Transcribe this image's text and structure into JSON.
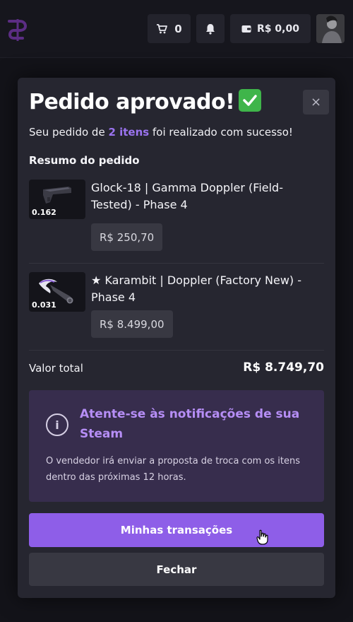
{
  "header": {
    "cart_count": "0",
    "wallet_balance": "R$ 0,00",
    "icons": {
      "logo": "site-logo",
      "cart": "cart-icon",
      "bell": "bell-icon",
      "wallet": "wallet-icon"
    }
  },
  "modal": {
    "title": "Pedido aprovado!",
    "close_label": "×",
    "subtitle_prefix": "Seu pedido de ",
    "subtitle_highlight": "2 itens",
    "subtitle_suffix": " foi realizado com sucesso!",
    "summary_title": "Resumo do pedido",
    "items": [
      {
        "float": "0.162",
        "name": "Glock-18 | Gamma Doppler (Field-Tested) - Phase 4",
        "price": "R$ 250,70"
      },
      {
        "float": "0.031",
        "name": "★ Karambit | Doppler (Factory New) - Phase 4",
        "price": "R$ 8.499,00"
      }
    ],
    "total_label": "Valor total",
    "total_value": "R$ 8.749,70",
    "notice": {
      "title": "Atente-se às notificações de sua Steam",
      "text": "O vendedor irá enviar a proposta de troca com os itens dentro das próximas 12 horas."
    },
    "primary_button": "Minhas transações",
    "secondary_button": "Fechar"
  },
  "colors": {
    "accent": "#8e5ee8",
    "highlight": "#9b74f0",
    "notice_bg": "#372d4d",
    "notice_title": "#b68ef6",
    "success": "#3fb54a"
  }
}
